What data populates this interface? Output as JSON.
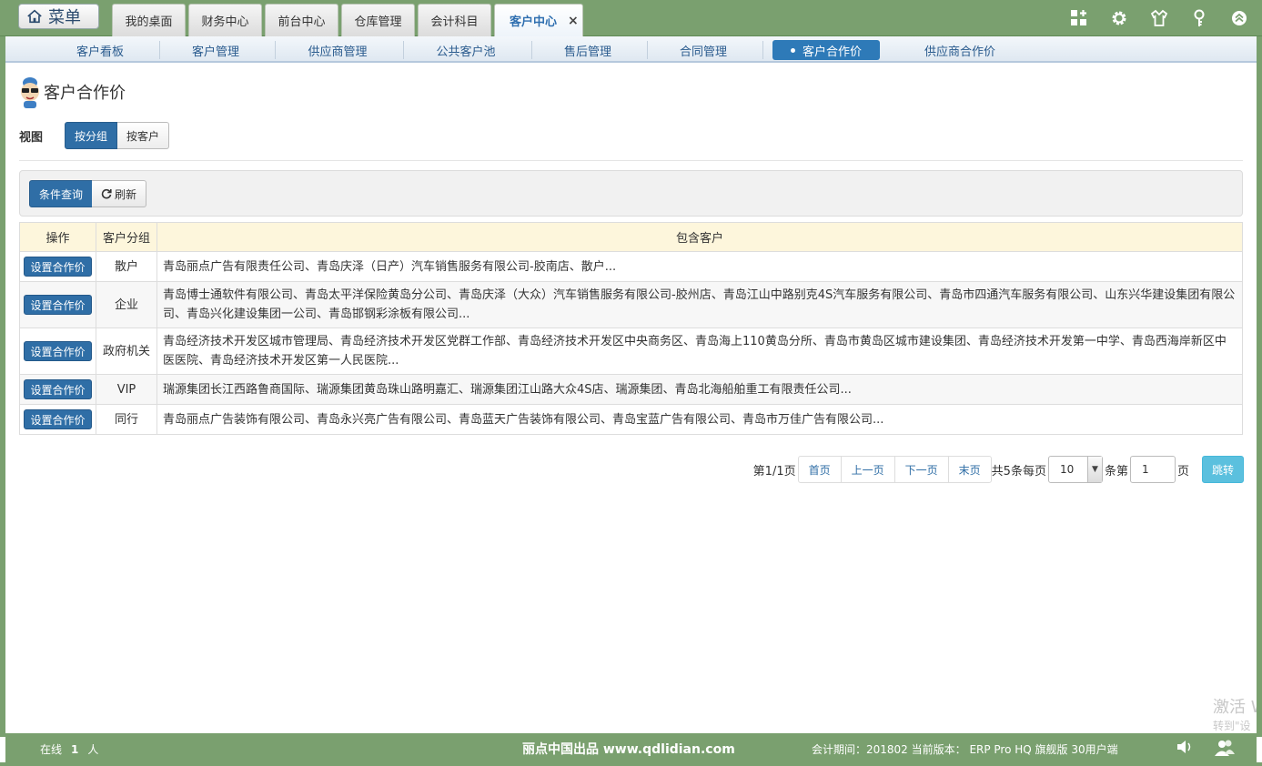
{
  "topbar": {
    "menu_label": "菜单",
    "tabs": [
      {
        "label": "我的桌面"
      },
      {
        "label": "财务中心"
      },
      {
        "label": "前台中心"
      },
      {
        "label": "仓库管理"
      },
      {
        "label": "会计科目"
      },
      {
        "label": "客户中心",
        "close": "×"
      }
    ],
    "icons": [
      "grid-add-icon",
      "gear-icon",
      "shirt-icon",
      "key-icon",
      "collapse-up-icon"
    ]
  },
  "subnav": {
    "items": [
      {
        "label": "客户看板"
      },
      {
        "label": "客户管理"
      },
      {
        "label": "供应商管理"
      },
      {
        "label": "公共客户池"
      },
      {
        "label": "售后管理"
      },
      {
        "label": "合同管理"
      },
      {
        "label": "客户合作价"
      },
      {
        "label": "供应商合作价"
      }
    ],
    "active_index": 6
  },
  "page": {
    "title": "客户合作价",
    "view_label": "视图",
    "view_by_group": "按分组",
    "view_by_customer": "按客户"
  },
  "toolbar": {
    "query_label": "条件查询",
    "refresh_label": "刷新"
  },
  "table": {
    "headers": [
      "操作",
      "客户分组",
      "包含客户"
    ],
    "op_label": "设置合作价",
    "rows": [
      {
        "group": "散户",
        "customers": "青岛丽点广告有限责任公司、青岛庆泽（日产）汽车销售服务有限公司-胶南店、散户..."
      },
      {
        "group": "企业",
        "customers": "青岛博士通软件有限公司、青岛太平洋保险黄岛分公司、青岛庆泽（大众）汽车销售服务有限公司-胶州店、青岛江山中路别克4S汽车服务有限公司、青岛市四通汽车服务有限公司、山东兴华建设集团有限公司、青岛兴化建设集团一公司、青岛邯钢彩涂板有限公司..."
      },
      {
        "group": "政府机关",
        "customers": "青岛经济技术开发区城市管理局、青岛经济技术开发区党群工作部、青岛经济技术开发区中央商务区、青岛海上110黄岛分所、青岛市黄岛区城市建设集团、青岛经济技术开发第一中学、青岛西海岸新区中医医院、青岛经济技术开发区第一人民医院..."
      },
      {
        "group": "VIP",
        "customers": "瑞源集团长江西路鲁商国际、瑞源集团黄岛珠山路明嘉汇、瑞源集团江山路大众4S店、瑞源集团、青岛北海船舶重工有限责任公司..."
      },
      {
        "group": "同行",
        "customers": "青岛丽点广告装饰有限公司、青岛永兴亮广告有限公司、青岛蓝天广告装饰有限公司、青岛宝蓝广告有限公司、青岛市万佳广告有限公司..."
      }
    ]
  },
  "pager": {
    "page_info": "第1/1页",
    "first": "首页",
    "prev": "上一页",
    "next": "下一页",
    "last": "末页",
    "total_text": "共5条每页",
    "page_size": "10",
    "unit_text": "条第",
    "page_input": "1",
    "page_suffix": "页",
    "go_label": "跳转"
  },
  "watermark": {
    "line1": "激活 W",
    "line2": "转到\"设"
  },
  "footer": {
    "online_prefix": "在线",
    "online_count": "1",
    "online_suffix": "人",
    "brand": "丽点中国出品 www.qdlidian.com",
    "info": "会计期间：201802 当前版本： ERP Pro HQ 旗舰版 30用户端",
    "icons": [
      "speaker-icon",
      "users-icon"
    ]
  }
}
